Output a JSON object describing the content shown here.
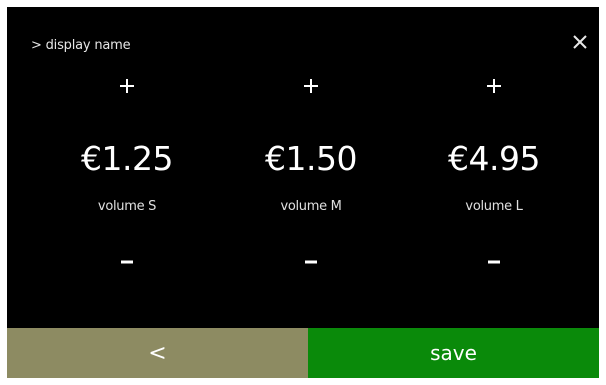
{
  "header": {
    "breadcrumb": "> display name",
    "close_icon": "close-icon"
  },
  "prices": [
    {
      "amount": "€1.25",
      "label": "volume S",
      "increase_icon": "plus-icon",
      "decrease_icon": "minus-icon"
    },
    {
      "amount": "€1.50",
      "label": "volume M",
      "increase_icon": "plus-icon",
      "decrease_icon": "minus-icon"
    },
    {
      "amount": "€4.95",
      "label": "volume L",
      "increase_icon": "plus-icon",
      "decrease_icon": "minus-icon"
    }
  ],
  "footer": {
    "back_label": "<",
    "save_label": "save"
  },
  "colors": {
    "background": "#000000",
    "text": "#ffffff",
    "back_button": "#8d8b62",
    "save_button": "#0a8a0a"
  }
}
